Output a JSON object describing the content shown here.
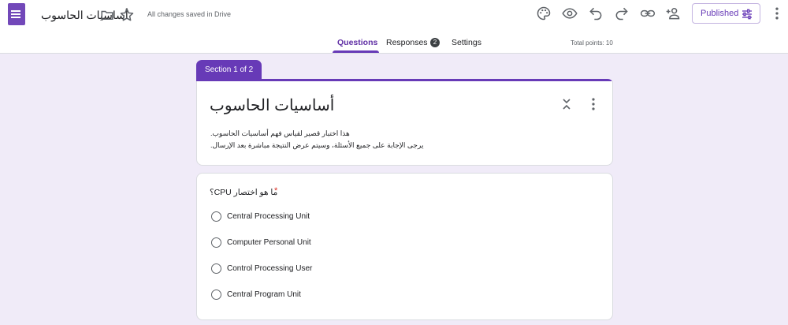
{
  "header": {
    "doc_title": "أساسيات الحاسوب",
    "save_status": "All changes saved in Drive",
    "icons": [
      "forms-logo-icon",
      "folder-icon",
      "star-icon",
      "palette-icon",
      "preview-eye-icon",
      "undo-icon",
      "redo-icon",
      "link-icon",
      "add-collaborator-icon",
      "publish-settings-icon",
      "more-vert-icon"
    ],
    "published_label": "Published",
    "accent_color": "#673ab7"
  },
  "tabs": {
    "questions": "Questions",
    "responses": "Responses",
    "responses_count": "2",
    "settings": "Settings",
    "active": "Questions"
  },
  "total_points": "Total points: 10",
  "section": {
    "label": "Section 1 of 2",
    "title": "أساسيات الحاسوب",
    "description_line1": "هذا اختبار قصير لقياس فهم أساسيات الحاسوب.",
    "description_line2": "يرجى الإجابة على جميع الأسئلة، وسيتم عرض النتيجة مباشرة بعد الإرسال."
  },
  "question": {
    "text": "ما هو اختصار CPU؟",
    "required_marker": "*",
    "options": [
      "Central Processing Unit",
      "Computer Personal Unit",
      "Control Processing User",
      "Central Program Unit"
    ]
  }
}
